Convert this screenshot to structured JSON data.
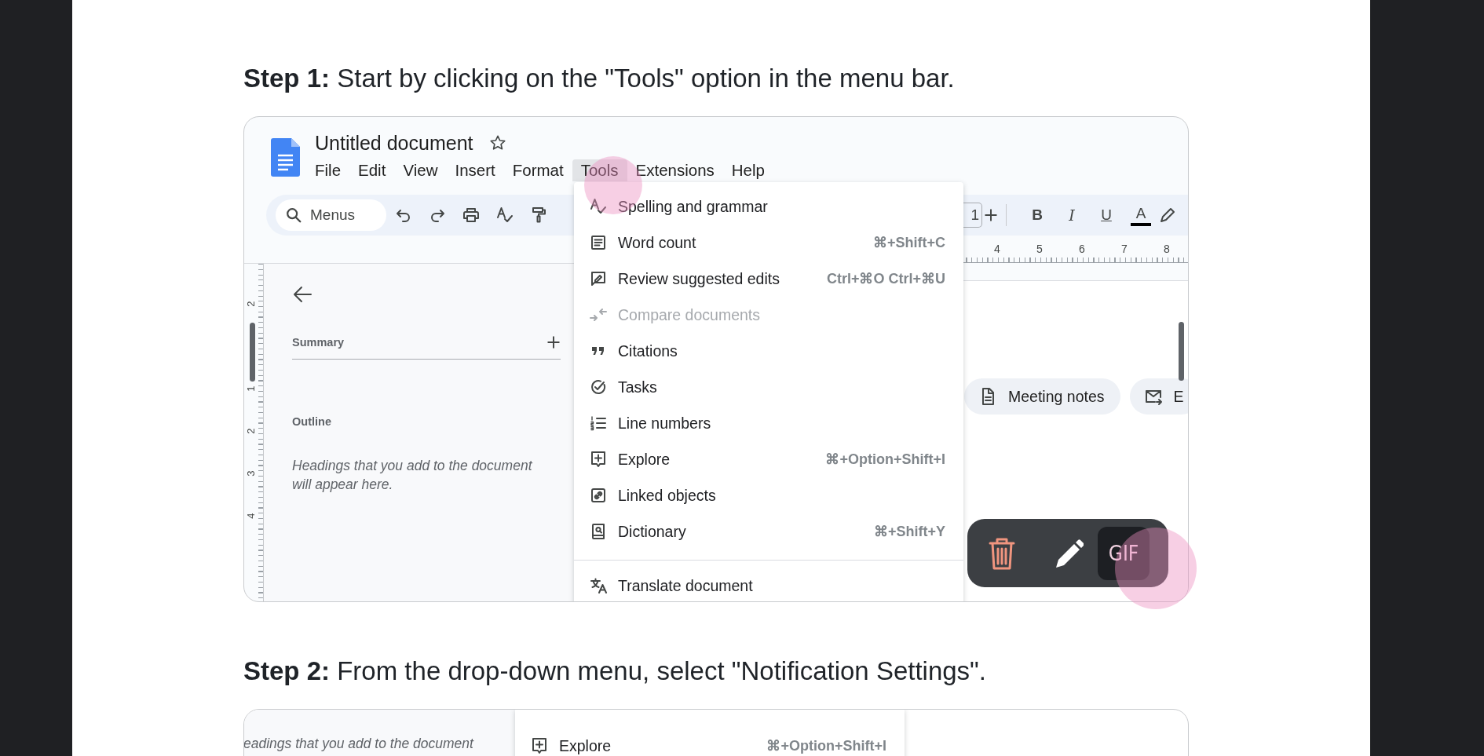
{
  "steps": [
    {
      "heading": "**Step 1:** Start by clicking on the \"Tools\" option in the menu bar.",
      "screenshot": {
        "kind": "full",
        "doc_title": "Untitled document",
        "menu_bar": [
          {
            "label": "File",
            "selected": false
          },
          {
            "label": "Edit",
            "selected": false
          },
          {
            "label": "View",
            "selected": false
          },
          {
            "label": "Insert",
            "selected": false
          },
          {
            "label": "Format",
            "selected": false
          },
          {
            "label": "Tools",
            "selected": true
          },
          {
            "label": "Extensions",
            "selected": false
          },
          {
            "label": "Help",
            "selected": false
          }
        ],
        "search": {
          "placeholder": "Menus"
        },
        "font_size": "1",
        "format_buttons": [
          "B",
          "I",
          "U",
          "A"
        ],
        "ruler_numbers": [
          "4",
          "5",
          "6",
          "7",
          "8"
        ],
        "vertical_ruler_numbers": [
          "2",
          "1",
          "2",
          "3",
          "4"
        ],
        "outline": {
          "summary_label": "Summary",
          "outline_label": "Outline",
          "hint": "Headings that you add to the document will appear here."
        },
        "chips": [
          {
            "label": "Meeting notes"
          },
          {
            "label": "E"
          }
        ],
        "tools_menu": [
          {
            "kind": "item",
            "label": "Spelling and grammar",
            "disabled": false
          },
          {
            "kind": "item",
            "label": "Word count",
            "shortcut": "⌘+Shift+C",
            "disabled": false
          },
          {
            "kind": "item",
            "label": "Review suggested edits",
            "shortcut": "Ctrl+⌘O Ctrl+⌘U",
            "disabled": false
          },
          {
            "kind": "item",
            "label": "Compare documents",
            "disabled": true
          },
          {
            "kind": "item",
            "label": "Citations",
            "disabled": false
          },
          {
            "kind": "item",
            "label": "Tasks",
            "disabled": false
          },
          {
            "kind": "item",
            "label": "Line numbers",
            "disabled": false
          },
          {
            "kind": "item",
            "label": "Explore",
            "shortcut": "⌘+Option+Shift+I",
            "disabled": false
          },
          {
            "kind": "item",
            "label": "Linked objects",
            "disabled": false
          },
          {
            "kind": "item",
            "label": "Dictionary",
            "shortcut": "⌘+Shift+Y",
            "disabled": false
          },
          {
            "kind": "separator"
          },
          {
            "kind": "item",
            "label": "Translate document",
            "disabled": false
          }
        ],
        "floating_toolbar": {
          "gif_label": "GIF"
        }
      }
    },
    {
      "heading": "**Step 2:** From the drop-down menu, select \"Notification Settings\".",
      "screenshot": {
        "kind": "crop",
        "hint": "eadings that you add to the document",
        "tools_menu": [
          {
            "kind": "item",
            "label": "Explore",
            "shortcut": "⌘+Option+Shift+I",
            "disabled": false
          }
        ]
      }
    }
  ]
}
